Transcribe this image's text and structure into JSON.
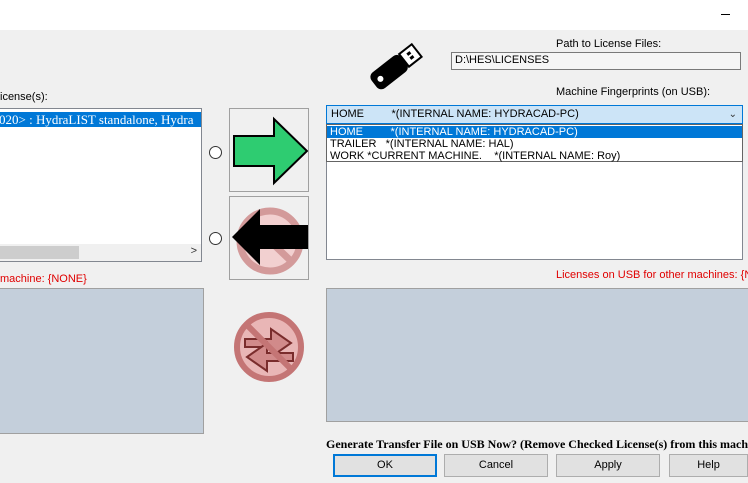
{
  "window": {
    "minimize_icon": "minimize-icon"
  },
  "path_section": {
    "label": "Path to License Files:",
    "value": "D:\\HES\\LICENSES",
    "usb_icon": "usb-drive-icon"
  },
  "licenses": {
    "label": "icense(s):",
    "items": [
      "020> : HydraLIST standalone, Hydra"
    ]
  },
  "fingerprints": {
    "label": "Machine Fingerprints (on USB):",
    "selected": "HOME         *(INTERNAL NAME: HYDRACAD-PC)",
    "options": [
      "HOME         *(INTERNAL NAME: HYDRACAD-PC)",
      "TRAILER   *(INTERNAL NAME: HAL)",
      "WORK *CURRENT MACHINE.    *(INTERNAL NAME: Roy)"
    ]
  },
  "machine_label": "machine:  {NONE}",
  "usb_other_label": "Licenses on USB for other machines:  {NO",
  "generate_label": "Generate Transfer File on USB Now? (Remove Checked License(s) from this mach",
  "buttons": {
    "ok": "OK",
    "cancel": "Cancel",
    "apply": "Apply",
    "help": "Help"
  },
  "colors": {
    "selection": "#0078d7",
    "arrow_green": "#2ecc71",
    "warning_red": "#e00000",
    "panel_blue_gray": "#c4cfdb"
  }
}
